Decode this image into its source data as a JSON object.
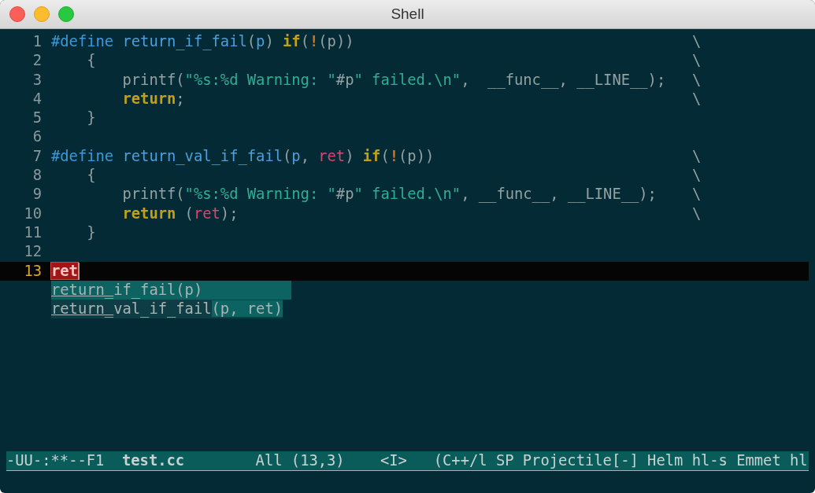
{
  "window": {
    "title": "Shell"
  },
  "lines": [
    {
      "number": "1",
      "current": false,
      "tokens": [
        {
          "kind": "preproc",
          "text": "#define "
        },
        {
          "kind": "func",
          "text": "return_if_fail"
        },
        {
          "kind": "plain",
          "text": "("
        },
        {
          "kind": "func",
          "text": "p"
        },
        {
          "kind": "plain",
          "text": ") "
        },
        {
          "kind": "keyword",
          "text": "if"
        },
        {
          "kind": "plain",
          "text": "("
        },
        {
          "kind": "bang",
          "text": "!"
        },
        {
          "kind": "plain",
          "text": "(p))"
        }
      ],
      "continuation": "\\"
    },
    {
      "number": "2",
      "current": false,
      "tokens": [
        {
          "kind": "plain",
          "text": "    {"
        }
      ],
      "continuation": "\\"
    },
    {
      "number": "3",
      "current": false,
      "tokens": [
        {
          "kind": "plain",
          "text": "        printf("
        },
        {
          "kind": "string",
          "text": "\"%s:%d Warning: \""
        },
        {
          "kind": "plain",
          "text": "#p"
        },
        {
          "kind": "string",
          "text": "\" failed.\\n\""
        },
        {
          "kind": "plain",
          "text": ",  __func__, __LINE__);"
        }
      ],
      "continuation": "\\"
    },
    {
      "number": "4",
      "current": false,
      "tokens": [
        {
          "kind": "keyword",
          "text": "        return"
        },
        {
          "kind": "plain",
          "text": ";"
        }
      ],
      "continuation": "\\"
    },
    {
      "number": "5",
      "current": false,
      "tokens": [
        {
          "kind": "plain",
          "text": "    }"
        }
      ]
    },
    {
      "number": "6",
      "current": false
    },
    {
      "number": "7",
      "current": false,
      "tokens": [
        {
          "kind": "preproc",
          "text": "#define "
        },
        {
          "kind": "func",
          "text": "return_val_if_fail"
        },
        {
          "kind": "plain",
          "text": "("
        },
        {
          "kind": "func",
          "text": "p"
        },
        {
          "kind": "plain",
          "text": ", "
        },
        {
          "kind": "var",
          "text": "ret"
        },
        {
          "kind": "plain",
          "text": ") "
        },
        {
          "kind": "keyword",
          "text": "if"
        },
        {
          "kind": "plain",
          "text": "("
        },
        {
          "kind": "bang",
          "text": "!"
        },
        {
          "kind": "plain",
          "text": "(p))"
        }
      ],
      "continuation": "\\"
    },
    {
      "number": "8",
      "current": false,
      "tokens": [
        {
          "kind": "plain",
          "text": "    {"
        }
      ],
      "continuation": "\\"
    },
    {
      "number": "9",
      "current": false,
      "tokens": [
        {
          "kind": "plain",
          "text": "        printf("
        },
        {
          "kind": "string",
          "text": "\"%s:%d Warning: \""
        },
        {
          "kind": "plain",
          "text": "#p"
        },
        {
          "kind": "string",
          "text": "\" failed.\\n\""
        },
        {
          "kind": "plain",
          "text": ", __func__, __LINE__);"
        }
      ],
      "continuation": "\\"
    },
    {
      "number": "10",
      "current": false,
      "tokens": [
        {
          "kind": "keyword",
          "text": "        return"
        },
        {
          "kind": "plain",
          "text": " ("
        },
        {
          "kind": "var",
          "text": "ret"
        },
        {
          "kind": "plain",
          "text": ");"
        }
      ],
      "continuation": "\\"
    },
    {
      "number": "11",
      "current": false,
      "tokens": [
        {
          "kind": "plain",
          "text": "    }"
        }
      ]
    },
    {
      "number": "12",
      "current": false
    },
    {
      "number": "13",
      "current": true,
      "tokens": [
        {
          "kind": "completion-input",
          "text": "ret"
        }
      ]
    }
  ],
  "completions": [
    {
      "match": "return_",
      "name_rest": "if_fail",
      "args": "(p)",
      "selected": true
    },
    {
      "match": "return_",
      "name_rest": "val_if_fail",
      "args": "(p, ret)",
      "selected": false
    }
  ],
  "mode_line": {
    "status": "-UU-:**--F1",
    "buffer": "test.cc",
    "position": "All (13,3)",
    "state": "<I>",
    "modes": "(C++/l SP Projectile[-] Helm hl-s Emmet hl"
  }
}
